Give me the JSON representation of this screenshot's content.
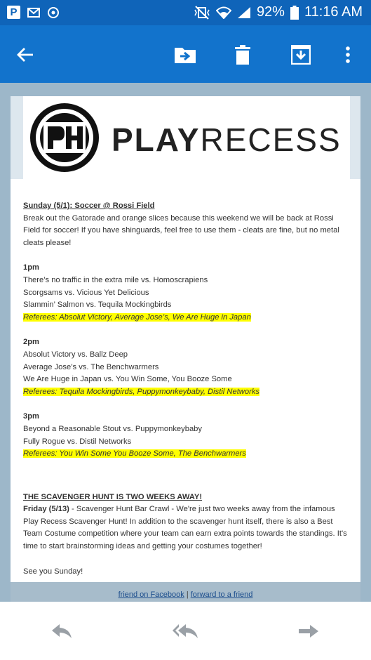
{
  "status_bar": {
    "left_icons": [
      "p-icon",
      "mail-icon",
      "sync-icon"
    ],
    "battery": "92%",
    "time": "11:16 AM"
  },
  "action_bar": {
    "icons": [
      "back-arrow-icon",
      "move-to-folder-icon",
      "trash-icon",
      "save-download-icon",
      "more-vert-icon"
    ]
  },
  "logo": {
    "bold": "PLAY",
    "regular": "RECESS"
  },
  "email": {
    "heading1": "Sunday (5/1): Soccer @ Rossi Field",
    "intro": "Break out the Gatorade and orange slices because this weekend we will be back at Rossi Field for soccer! If you have shinguards, feel free to use them - cleats are fine, but no metal cleats please!",
    "slots": [
      {
        "time": "1pm",
        "games": [
          "There’s no traffic in the extra mile vs. Homoscrapiens",
          "Scorgsams vs. Vicious Yet Delicious",
          "Slammin’ Salmon vs. Tequila Mockingbirds"
        ],
        "referees": "Referees: Absolut Victory, Average Jose’s, We Are Huge in Japan"
      },
      {
        "time": "2pm",
        "games": [
          "Absolut Victory vs. Ballz Deep",
          "Average Jose’s vs. The Benchwarmers",
          "We Are Huge in Japan vs. You Win Some, You Booze Some"
        ],
        "referees": "Referees: Tequila Mockingbirds, Puppymonkeybaby, Distil Networks"
      },
      {
        "time": "3pm",
        "games": [
          "Beyond a Reasonable Stout vs. Puppymonkeybaby",
          "Fully Rogue vs. Distil Networks"
        ],
        "referees": "Referees: You Win Some You Booze Some, The Benchwarmers"
      }
    ],
    "heading2": "THE SCAVENGER HUNT IS TWO WEEKS AWAY!",
    "hunt_date": "Friday (5/13)",
    "hunt_text": " - Scavenger Hunt Bar Crawl  - We're just two weeks away from the infamous Play Recess Scavenger Hunt! In addition to the scavenger hunt itself, there is also a Best Team Costume competition where your team can earn extra points towards the standings. It's time to start brainstorming ideas and getting your costumes together!",
    "signoff": "See you Sunday!"
  },
  "footer": {
    "link1": "friend on Facebook",
    "separator": "|",
    "link2": "forward to a friend"
  },
  "bottom_nav": {
    "icons": [
      "reply-icon",
      "reply-all-icon",
      "forward-icon"
    ]
  },
  "colors": {
    "status_bar": "#0f64b9",
    "action_bar": "#1273cc",
    "highlight": "#ffff00",
    "background": "#9db7c9"
  }
}
